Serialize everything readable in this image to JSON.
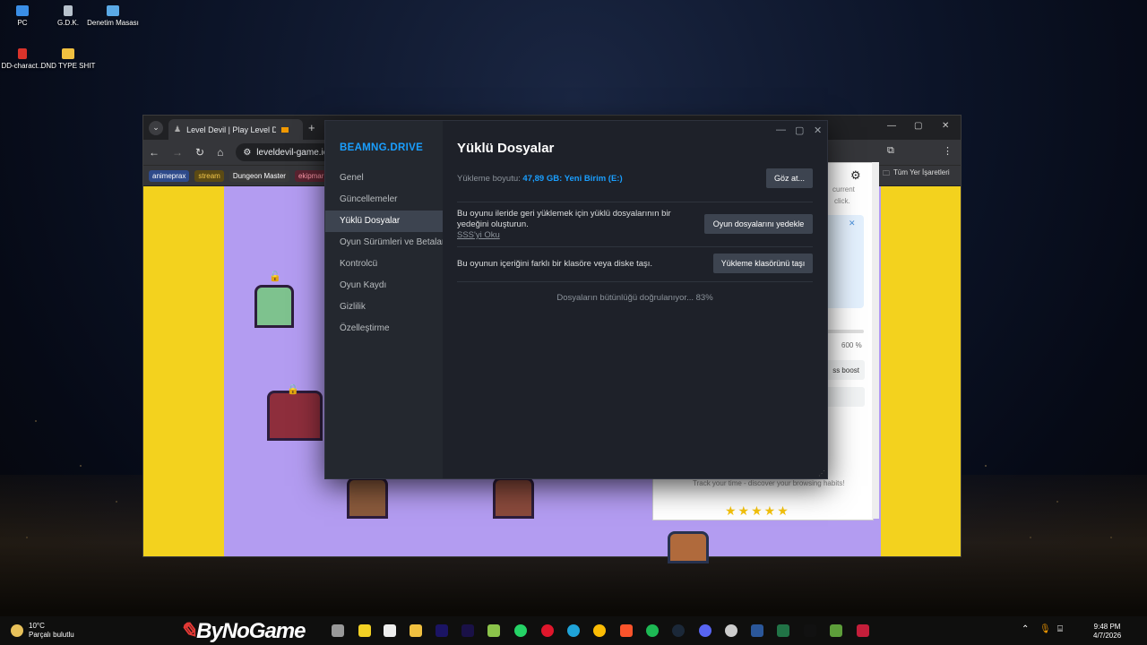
{
  "desktop": {
    "icons": [
      {
        "label": "PC"
      },
      {
        "label": "G.D.K."
      },
      {
        "label": "Denetim Masası"
      },
      {
        "label": "DD-charact..."
      },
      {
        "label": "DND TYPE SHIT"
      }
    ]
  },
  "browser": {
    "tab_title": "Level Devil | Play Level Devil",
    "new_tab": "+",
    "url": "leveldevil-game.io",
    "bookmarks": [
      "animeprax",
      "stream",
      "Dungeon Master",
      "ekipmar"
    ],
    "all_bookmarks": "Tüm Yer İşaretleri"
  },
  "extension": {
    "text1": "current",
    "text2": "click.",
    "zoom": "600 %",
    "boost": "ss boost",
    "footer": "Track your time - discover your browsing habits!",
    "stars": "★★★★★"
  },
  "steam": {
    "brand": "BEAMNG.DRIVE",
    "nav": [
      "Genel",
      "Güncellemeler",
      "Yüklü Dosyalar",
      "Oyun Sürümleri ve Betalar",
      "Kontrolcü",
      "Oyun Kaydı",
      "Gizlilik",
      "Özelleştirme"
    ],
    "title": "Yüklü Dosyalar",
    "size_label": "Yükleme boyutu:",
    "size_value": "47,89 GB: Yeni Birim (E:)",
    "browse": "Göz at...",
    "backup_text": "Bu oyunu ileride geri yüklemek için yüklü dosyalarının bir yedeğini oluşturun.",
    "faq": "SSS'yi Oku",
    "backup_btn": "Oyun dosyalarını yedekle",
    "move_text": "Bu oyunun içeriğini farklı bir klasöre veya diske taşı.",
    "move_btn": "Yükleme klasörünü taşı",
    "verify": "Dosyaların bütünlüğü doğrulanıyor... 83%"
  },
  "taskbar": {
    "weather_temp": "10°C",
    "weather_desc": "Parçalı bulutlu",
    "watermark": "ByNoGame",
    "time": "9:48 PM",
    "date": "4/7/2026"
  }
}
